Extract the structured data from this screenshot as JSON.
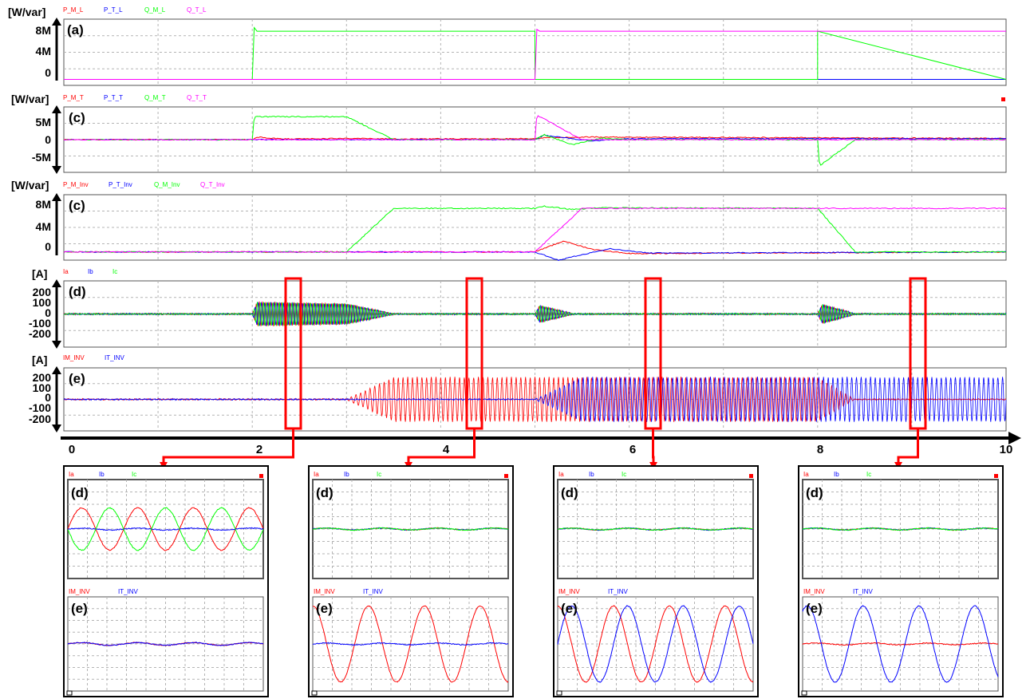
{
  "colors": {
    "red": "#ff0000",
    "blue": "#0000ff",
    "green": "#00ff00",
    "magenta": "#ff00ff",
    "highlight": "#ff0000",
    "grid": "#b4b4b4"
  },
  "chart_data": [
    {
      "type": "line",
      "panel": "(a)",
      "unit": "[W/var]",
      "legend": [
        "P_M_L",
        "P_T_L",
        "Q_M_L",
        "Q_T_L"
      ],
      "yticks": [
        "8M",
        "4M",
        "0"
      ],
      "ylim": [
        -1,
        10
      ],
      "xlim": [
        0,
        10
      ],
      "series": [
        {
          "name": "P_M_L",
          "color": "#ff0000",
          "x": [
            0,
            10
          ],
          "y": [
            0,
            0
          ]
        },
        {
          "name": "P_T_L",
          "color": "#0000ff",
          "x": [
            0,
            10
          ],
          "y": [
            0,
            0
          ]
        },
        {
          "name": "Q_M_L",
          "color": "#00ff00",
          "x": [
            0,
            2,
            2.02,
            2.05,
            5,
            5,
            8,
            8,
            10
          ],
          "y": [
            0,
            0,
            8.6,
            8,
            8,
            0,
            0,
            8,
            0
          ]
        },
        {
          "name": "Q_T_L",
          "color": "#ff00ff",
          "x": [
            0,
            5,
            5.02,
            5.05,
            10
          ],
          "y": [
            0,
            0,
            8.3,
            8,
            8
          ]
        }
      ]
    },
    {
      "type": "line",
      "panel": "(c)",
      "unit": "[W/var]",
      "legend": [
        "P_M_T",
        "P_T_T",
        "Q_M_T",
        "Q_T_T"
      ],
      "yticks": [
        "5M",
        "0",
        "-5M"
      ],
      "ylim": [
        -10,
        10
      ],
      "xlim": [
        0,
        10
      ],
      "series": [
        {
          "name": "P_M_T",
          "color": "#ff0000",
          "x": [
            0,
            2,
            2.05,
            2.3,
            3.2,
            3.5,
            5,
            5.1,
            5.5,
            10
          ],
          "y": [
            0,
            0,
            0.8,
            0.2,
            0.4,
            0.2,
            0.3,
            0.6,
            0.8,
            0.4
          ]
        },
        {
          "name": "P_T_T",
          "color": "#0000ff",
          "x": [
            0,
            5,
            5.1,
            5.3,
            5.6,
            6,
            10
          ],
          "y": [
            0,
            0,
            1.4,
            0.6,
            -0.4,
            0.3,
            0.3
          ]
        },
        {
          "name": "Q_M_T",
          "color": "#00ff00",
          "x": [
            0,
            2,
            2.02,
            3,
            3.5,
            5,
            5.1,
            5.4,
            5.7,
            6,
            8,
            8.02,
            8.4,
            10
          ],
          "y": [
            0,
            0,
            7,
            7,
            0,
            0,
            1.5,
            -1.5,
            0.5,
            0,
            0,
            -8,
            0,
            0
          ]
        },
        {
          "name": "Q_T_T",
          "color": "#ff00ff",
          "x": [
            0,
            5,
            5.02,
            5.5,
            10
          ],
          "y": [
            0,
            0,
            7.5,
            0,
            0
          ]
        }
      ]
    },
    {
      "type": "line",
      "panel": "(c)",
      "unit": "[W/var]",
      "legend": [
        "P_M_Inv",
        "P_T_Inv",
        "Q_M_Inv",
        "Q_T_Inv"
      ],
      "yticks": [
        "8M",
        "4M",
        "0"
      ],
      "ylim": [
        -1.5,
        10.5
      ],
      "xlim": [
        0,
        10
      ],
      "series": [
        {
          "name": "P_M_Inv",
          "color": "#ff0000",
          "x": [
            0,
            5,
            5.3,
            5.6,
            6,
            10
          ],
          "y": [
            0,
            0,
            2,
            0.5,
            -0.3,
            0
          ]
        },
        {
          "name": "P_T_Inv",
          "color": "#0000ff",
          "x": [
            0,
            5,
            5.25,
            5.5,
            5.8,
            6.2,
            10
          ],
          "y": [
            0,
            0,
            -1.5,
            -0.5,
            0.6,
            -0.2,
            0
          ]
        },
        {
          "name": "Q_M_Inv",
          "color": "#00ff00",
          "x": [
            0,
            3,
            3.5,
            5,
            5.1,
            5.4,
            5.7,
            8,
            8.4,
            10
          ],
          "y": [
            0,
            0,
            8,
            8,
            8.4,
            7.8,
            8.1,
            8,
            0,
            0
          ]
        },
        {
          "name": "Q_T_Inv",
          "color": "#ff00ff",
          "x": [
            0,
            5,
            5.5,
            10
          ],
          "y": [
            0,
            0,
            8,
            8
          ]
        }
      ]
    },
    {
      "type": "line",
      "panel": "(d)",
      "unit": "[A]",
      "legend": [
        "Ia",
        "Ib",
        "Ic"
      ],
      "yticks": [
        "200",
        "100",
        "0",
        "-100",
        "-200"
      ],
      "ylim": [
        -300,
        300
      ],
      "xlim": [
        0,
        10
      ],
      "envelope_amplitude": {
        "x": [
          0,
          2,
          2.05,
          3,
          3.5,
          5,
          5.05,
          5.4,
          8,
          8.05,
          8.4,
          10
        ],
        "y": [
          5,
          5,
          110,
          95,
          5,
          5,
          80,
          5,
          5,
          90,
          5,
          5
        ]
      }
    },
    {
      "type": "line",
      "panel": "(e)",
      "unit": "[A]",
      "legend": [
        "IM_INV",
        "IT_INV"
      ],
      "yticks": [
        "200",
        "100",
        "0",
        "-100",
        "-200"
      ],
      "ylim": [
        -300,
        300
      ],
      "xlim": [
        0,
        10
      ],
      "envelope_amplitude_IM_INV": {
        "x": [
          0,
          3,
          3.5,
          5,
          5.5,
          8,
          8.4,
          10
        ],
        "y": [
          3,
          3,
          210,
          210,
          210,
          210,
          3,
          3
        ]
      },
      "envelope_amplitude_IT_INV": {
        "x": [
          0,
          5,
          5.5,
          10
        ],
        "y": [
          3,
          3,
          210,
          210
        ]
      }
    }
  ],
  "time_axis": {
    "ticks": [
      "0",
      "2",
      "4",
      "6",
      "8",
      "10"
    ],
    "range": [
      0,
      10
    ]
  },
  "zoom_panels": [
    {
      "upper": {
        "label": "(d)",
        "legend": [
          "Ia",
          "Ib",
          "Ic"
        ],
        "amplitudes": {
          "Ia": 0.45,
          "Ib": 0.02,
          "Ic": 0.45
        },
        "phase_deg": {
          "Ia": 0,
          "Ib": 0,
          "Ic": 180
        }
      },
      "lower": {
        "label": "(e)",
        "legend": [
          "IM_INV",
          "IT_INV"
        ],
        "amplitudes": {
          "IM_INV": 0.03,
          "IT_INV": 0.03
        },
        "phase_deg": {
          "IM_INV": 0,
          "IT_INV": 0
        }
      }
    },
    {
      "upper": {
        "label": "(d)",
        "legend": [
          "Ia",
          "Ib",
          "Ic"
        ],
        "amplitudes": {
          "Ia": 0.02,
          "Ib": 0.02,
          "Ic": 0.02
        },
        "phase_deg": {
          "Ia": 0,
          "Ib": 0,
          "Ic": 0
        }
      },
      "lower": {
        "label": "(e)",
        "legend": [
          "IM_INV",
          "IT_INV"
        ],
        "amplitudes": {
          "IM_INV": 0.85,
          "IT_INV": 0.02
        },
        "phase_deg": {
          "IM_INV": 90,
          "IT_INV": 0
        }
      }
    },
    {
      "upper": {
        "label": "(d)",
        "legend": [
          "Ia",
          "Ib",
          "Ic"
        ],
        "amplitudes": {
          "Ia": 0.02,
          "Ib": 0.02,
          "Ic": 0.02
        },
        "phase_deg": {
          "Ia": 0,
          "Ib": 0,
          "Ic": 0
        }
      },
      "lower": {
        "label": "(e)",
        "legend": [
          "IM_INV",
          "IT_INV"
        ],
        "amplitudes": {
          "IM_INV": 0.85,
          "IT_INV": 0.85
        },
        "phase_deg": {
          "IM_INV": 90,
          "IT_INV": 0
        }
      }
    },
    {
      "upper": {
        "label": "(d)",
        "legend": [
          "Ia",
          "Ib",
          "Ic"
        ],
        "amplitudes": {
          "Ia": 0.02,
          "Ib": 0.02,
          "Ic": 0.02
        },
        "phase_deg": {
          "Ia": 0,
          "Ib": 0,
          "Ic": 0
        }
      },
      "lower": {
        "label": "(e)",
        "legend": [
          "IM_INV",
          "IT_INV"
        ],
        "amplitudes": {
          "IM_INV": 0.02,
          "IT_INV": 0.85
        },
        "phase_deg": {
          "IM_INV": 0,
          "IT_INV": 60
        }
      }
    }
  ],
  "zoom_times": [
    2.3,
    4.3,
    6.3,
    9.3
  ]
}
